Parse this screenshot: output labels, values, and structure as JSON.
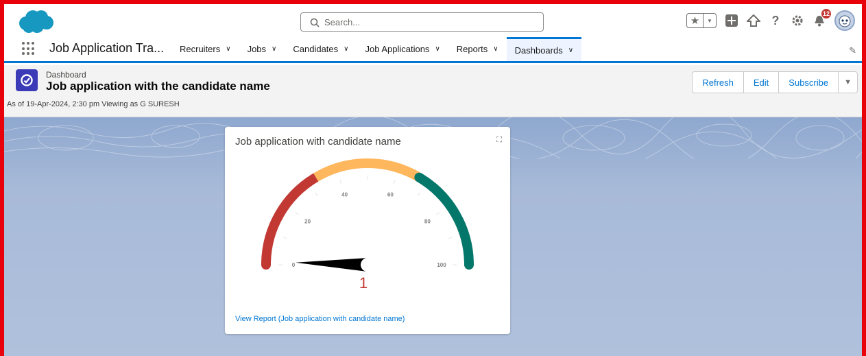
{
  "header": {
    "search_placeholder": "Search...",
    "notification_count": "12"
  },
  "nav": {
    "app_name": "Job Application Tra...",
    "tabs": [
      {
        "label": "Recruiters"
      },
      {
        "label": "Jobs"
      },
      {
        "label": "Candidates"
      },
      {
        "label": "Job Applications"
      },
      {
        "label": "Reports"
      },
      {
        "label": "Dashboards",
        "active": true
      }
    ]
  },
  "page": {
    "type": "Dashboard",
    "title": "Job application with the candidate name",
    "subtitle": "As of 19-Apr-2024, 2:30 pm Viewing as G SURESH",
    "buttons": {
      "refresh": "Refresh",
      "edit": "Edit",
      "subscribe": "Subscribe"
    }
  },
  "widget": {
    "title": "Job application with candidate name",
    "view_report": "View Report (Job application with candidate name)",
    "gauge": {
      "min": 0,
      "max": 100,
      "value": 1,
      "value_label": "1",
      "ticks": [
        "0",
        "20",
        "40",
        "60",
        "80",
        "100"
      ],
      "bands": [
        {
          "from": 0,
          "to": 33,
          "color": "#c23934"
        },
        {
          "from": 33,
          "to": 67,
          "color": "#ffb75d"
        },
        {
          "from": 67,
          "to": 100,
          "color": "#04776b"
        }
      ]
    }
  },
  "colors": {
    "brand_blue": "#0176d3",
    "icon_purple": "#3b3ab7",
    "value_red": "#c23934"
  }
}
